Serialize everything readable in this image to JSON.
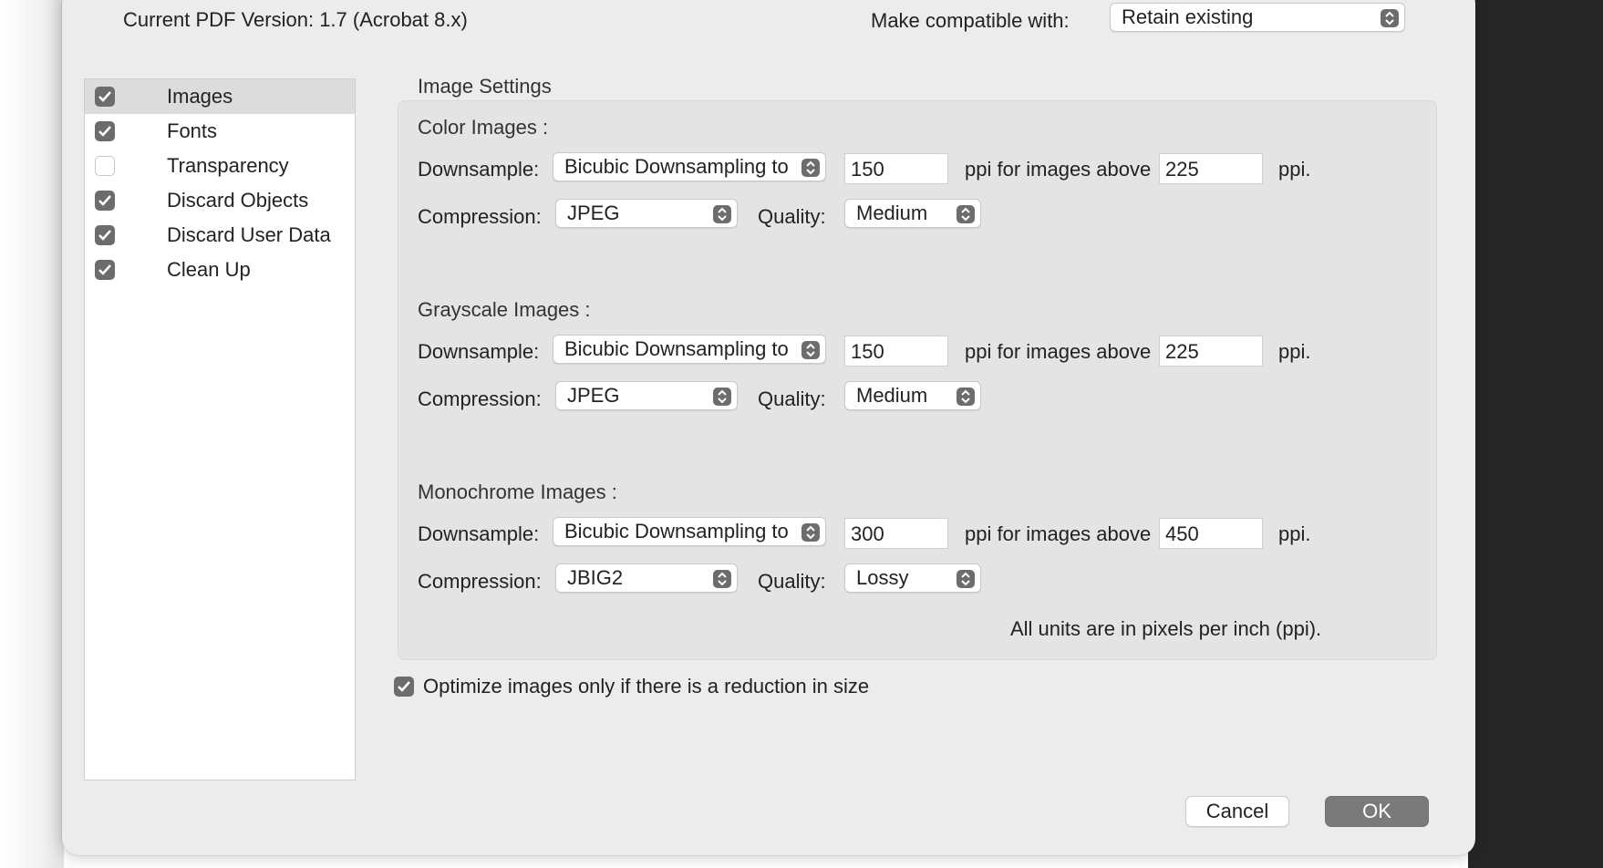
{
  "header": {
    "pdf_version_label": "Current PDF Version: 1.7 (Acrobat 8.x)",
    "compat_label": "Make compatible with:",
    "compat_value": "Retain existing"
  },
  "sidebar": {
    "items": [
      {
        "label": "Images",
        "checked": true,
        "selected": true
      },
      {
        "label": "Fonts",
        "checked": true,
        "selected": false
      },
      {
        "label": "Transparency",
        "checked": false,
        "selected": false
      },
      {
        "label": "Discard Objects",
        "checked": true,
        "selected": false
      },
      {
        "label": "Discard User Data",
        "checked": true,
        "selected": false
      },
      {
        "label": "Clean Up",
        "checked": true,
        "selected": false
      }
    ]
  },
  "image_settings": {
    "title": "Image Settings",
    "downsample_label": "Downsample:",
    "compression_label": "Compression:",
    "quality_label": "Quality:",
    "ppi_above_label": "ppi for images above",
    "ppi_label": "ppi.",
    "units_note": "All units are in pixels per inch (ppi).",
    "color": {
      "title": "Color Images :",
      "downsample": "Bicubic Downsampling to",
      "ppi": "150",
      "above": "225",
      "compression": "JPEG",
      "quality": "Medium"
    },
    "grayscale": {
      "title": "Grayscale Images :",
      "downsample": "Bicubic Downsampling to",
      "ppi": "150",
      "above": "225",
      "compression": "JPEG",
      "quality": "Medium"
    },
    "monochrome": {
      "title": "Monochrome Images :",
      "downsample": "Bicubic Downsampling to",
      "ppi": "300",
      "above": "450",
      "compression": "JBIG2",
      "quality": "Lossy"
    }
  },
  "optimize": {
    "label": "Optimize images only if there is a reduction in size",
    "checked": true
  },
  "buttons": {
    "cancel": "Cancel",
    "ok": "OK"
  }
}
